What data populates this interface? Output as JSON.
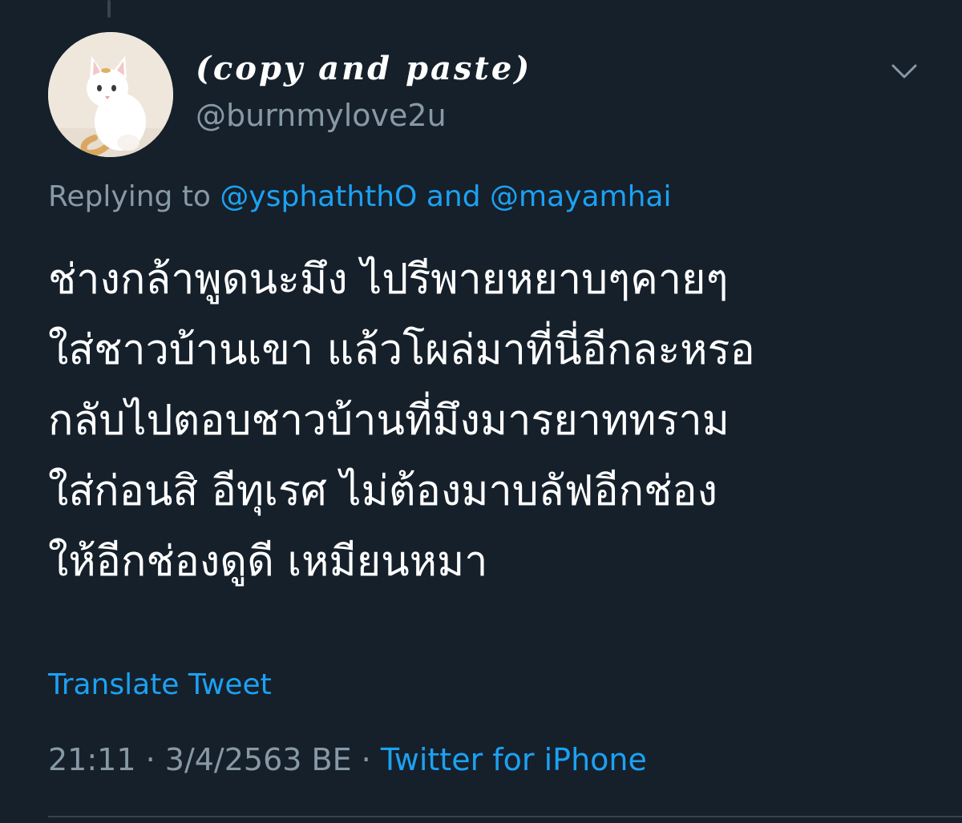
{
  "tweet": {
    "display_name": "(copy and paste)",
    "handle": "@burnmylove2u",
    "replying_prefix": "Replying to ",
    "mention_1": "@ysphaththO",
    "replying_conjunction": " and ",
    "mention_2": "@mayamhai",
    "text_lines": [
      "ช่างกล้าพูดนะมึง ไปรีพายหยาบๆคายๆ",
      " ใส่ชาวบ้านเขา แล้วโผล่มาที่นี่อีกละหรอ",
      "กลับไปตอบชาวบ้านที่มึงมารยาททราม",
      " ใส่ก่อนสิ อีทุเรศ ไม่ต้องมาบลัฟอีกช่อง",
      " ให้อีกช่องดูดี เหมียนหมา"
    ],
    "translate_label": "Translate Tweet",
    "time": "21:11",
    "separator_1": " · ",
    "date": "3/4/2563 BE",
    "separator_2": " · ",
    "source": "Twitter for iPhone"
  },
  "icons": {
    "menu": "chevron-down-icon",
    "avatar": "cat-avatar"
  },
  "colors": {
    "background": "#15202b",
    "text_primary": "#ffffff",
    "text_secondary": "#8899a6",
    "accent": "#1da1f2",
    "divider": "#38444d"
  }
}
